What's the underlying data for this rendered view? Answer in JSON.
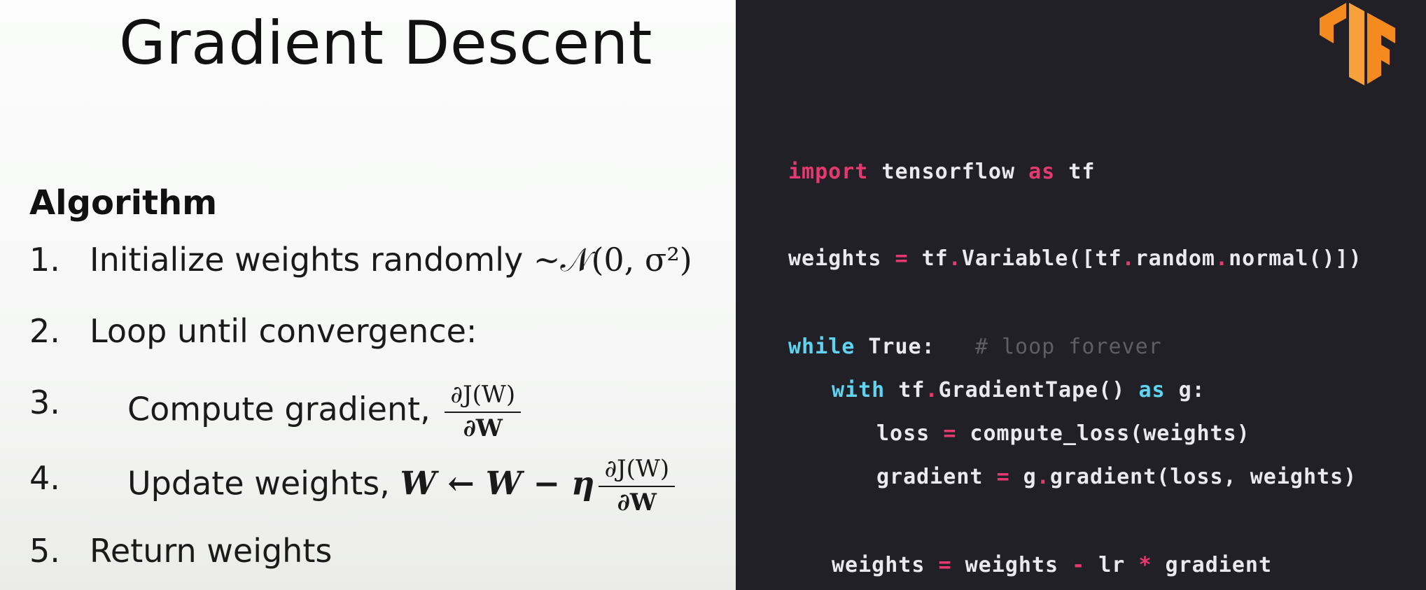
{
  "slide": {
    "title": "Gradient Descent",
    "algorithm_heading": "Algorithm",
    "steps": [
      {
        "num": "1.",
        "text": "Initialize weights randomly ",
        "math": "~𝒩(0, σ²)"
      },
      {
        "num": "2.",
        "text": "Loop until convergence:"
      },
      {
        "num": "3.",
        "text": "Compute gradient, ",
        "frac_num": "∂J(W)",
        "frac_den": "∂W"
      },
      {
        "num": "4.",
        "text": "Update weights, ",
        "math": "W ← W − η",
        "frac_num": "∂J(W)",
        "frac_den": "∂W"
      },
      {
        "num": "5.",
        "text": "Return weights"
      }
    ]
  },
  "code": {
    "line1": {
      "a": "import",
      "b": " tensorflow ",
      "c": "as",
      "d": " tf"
    },
    "line2": {
      "a": "weights ",
      "b": "=",
      "c": " tf",
      "d": ".",
      "e": "Variable([tf",
      "f": ".",
      "g": "random",
      "h": ".",
      "i": "normal()])"
    },
    "line3": {
      "a": "while",
      "b": " True:   ",
      "c": "# loop forever"
    },
    "line4": {
      "a": "with",
      "b": " tf",
      "c": ".",
      "d": "GradientTape() ",
      "e": "as",
      "f": " g:"
    },
    "line5": {
      "a": "loss ",
      "b": "=",
      "c": " compute_loss(weights)"
    },
    "line6": {
      "a": "gradient ",
      "b": "=",
      "c": " g",
      "d": ".",
      "e": "gradient(loss, weights)"
    },
    "line7": {
      "a": "weights ",
      "b": "=",
      "c": " weights ",
      "d": "-",
      "e": " lr ",
      "f": "*",
      "g": " gradient"
    }
  },
  "colors": {
    "keyword": "#e6396f",
    "keyword2": "#5fd3f0",
    "comment": "#5e5e66",
    "background_dark": "#222027",
    "logo": "#f58a1f"
  },
  "logo_icon": "tensorflow-logo-icon"
}
